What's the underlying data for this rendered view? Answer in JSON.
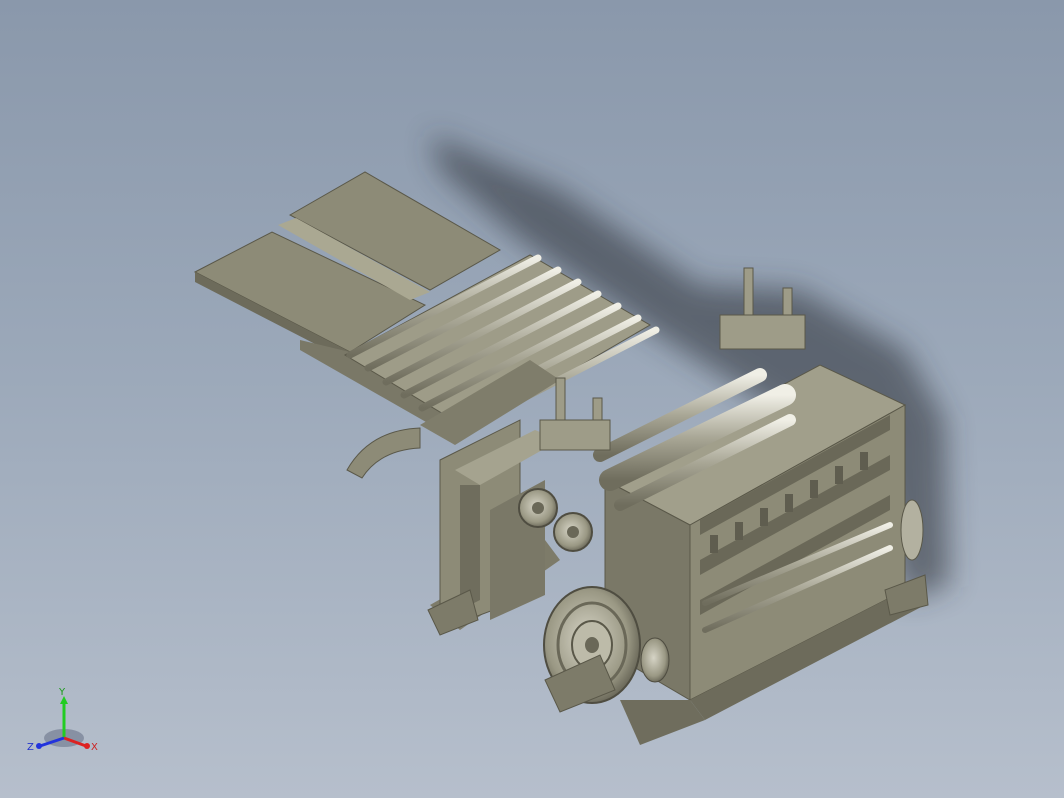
{
  "viewport": {
    "background_top": "#8a98ab",
    "background_bottom": "#b6bfcc",
    "model_color": "#8d8b77",
    "shadow_color": "#2b2f35"
  },
  "triad": {
    "y_label": "Y",
    "x_label": "X",
    "z_label": "Z",
    "y_color": "#22cc22",
    "x_color": "#dd2222",
    "z_color": "#2233dd"
  }
}
